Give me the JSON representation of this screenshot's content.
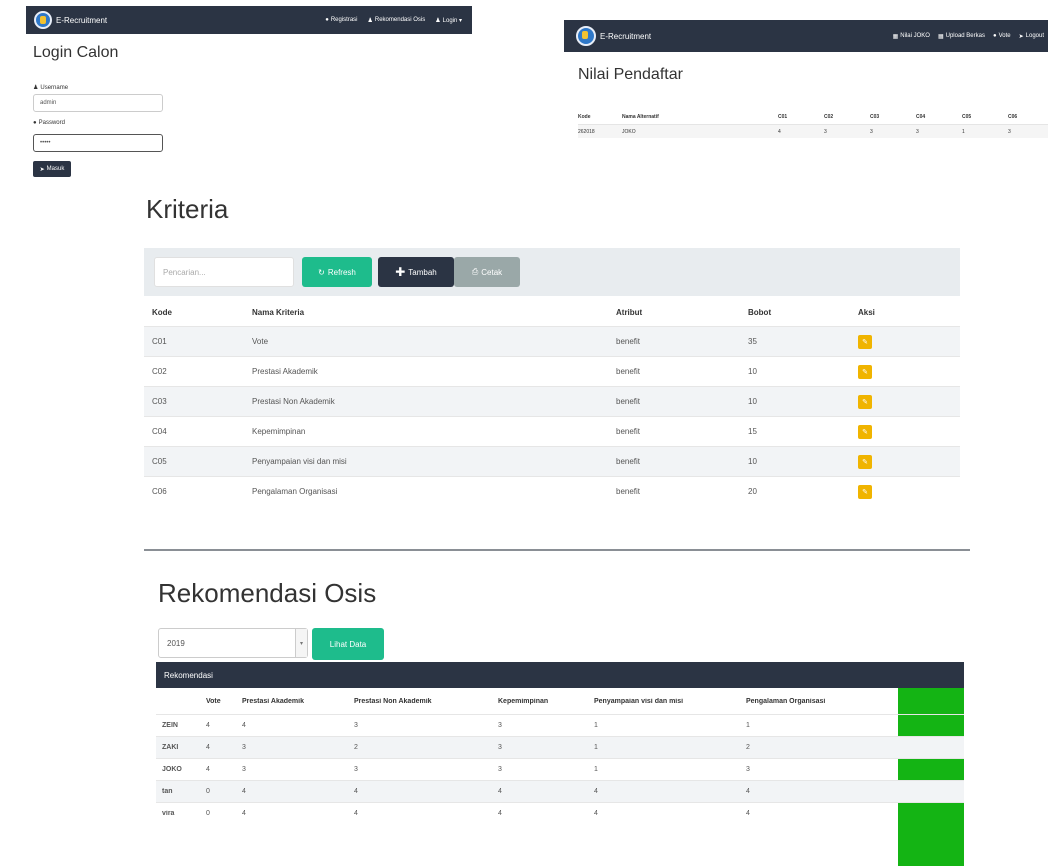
{
  "login_view": {
    "brand": "E-Recruitment",
    "nav": {
      "register": "Registrasi",
      "rekomendasi": "Rekomendasi Osis",
      "login": "Login ▾"
    },
    "title": "Login Calon",
    "username_label": "Username",
    "username_value": "admin",
    "password_label": "Password",
    "password_value": "•••••",
    "submit": "Masuk"
  },
  "nilai_view": {
    "brand": "E-Recruitment",
    "nav": {
      "nilai": "Nilai JOKO",
      "upload": "Upload Berkas",
      "vote": "Vote",
      "logout": "Logout"
    },
    "title": "Nilai Pendaftar",
    "headers": [
      "Kode",
      "Nama Alternatif",
      "C01",
      "C02",
      "C03",
      "C04",
      "C05",
      "C06"
    ],
    "row": [
      "262018",
      "JOKO",
      "4",
      "3",
      "3",
      "3",
      "1",
      "3"
    ]
  },
  "kriteria": {
    "title": "Kriteria",
    "search_placeholder": "Pencarian...",
    "refresh": "Refresh",
    "tambah": "Tambah",
    "cetak": "Cetak",
    "headers": {
      "kode": "Kode",
      "nama": "Nama Kriteria",
      "atribut": "Atribut",
      "bobot": "Bobot",
      "aksi": "Aksi"
    },
    "rows": [
      {
        "kode": "C01",
        "nama": "Vote",
        "atribut": "benefit",
        "bobot": "35"
      },
      {
        "kode": "C02",
        "nama": "Prestasi Akademik",
        "atribut": "benefit",
        "bobot": "10"
      },
      {
        "kode": "C03",
        "nama": "Prestasi Non Akademik",
        "atribut": "benefit",
        "bobot": "10"
      },
      {
        "kode": "C04",
        "nama": "Kepemimpinan",
        "atribut": "benefit",
        "bobot": "15"
      },
      {
        "kode": "C05",
        "nama": "Penyampaian visi dan misi",
        "atribut": "benefit",
        "bobot": "10"
      },
      {
        "kode": "C06",
        "nama": "Pengalaman Organisasi",
        "atribut": "benefit",
        "bobot": "20"
      }
    ]
  },
  "rekomendasi": {
    "title": "Rekomendasi Osis",
    "year": "2019",
    "lihat": "Lihat Data",
    "panel_title": "Rekomendasi",
    "headers": [
      "",
      "Vote",
      "Prestasi Akademik",
      "Prestasi Non Akademik",
      "Kepemimpinan",
      "Penyampaian visi dan misi",
      "Pengalaman Organisasi"
    ],
    "rows": [
      [
        "ZEIN",
        "4",
        "4",
        "3",
        "3",
        "1",
        "1"
      ],
      [
        "ZAKI",
        "4",
        "3",
        "2",
        "3",
        "1",
        "2"
      ],
      [
        "JOKO",
        "4",
        "3",
        "3",
        "3",
        "1",
        "3"
      ],
      [
        "tan",
        "0",
        "4",
        "4",
        "4",
        "4",
        "4"
      ],
      [
        "vira",
        "0",
        "4",
        "4",
        "4",
        "4",
        "4"
      ]
    ]
  },
  "colors": {
    "navbar": "#2b3444",
    "green": "#1ebc8c",
    "warning": "#f0b400",
    "highlight": "#14b414"
  }
}
